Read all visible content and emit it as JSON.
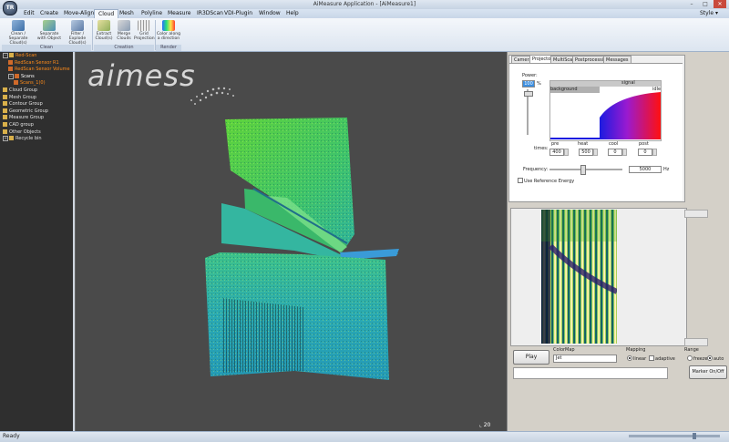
{
  "window": {
    "title": "AiMeasure Application - [AiMeasure1]",
    "logo_text": "TR",
    "minimize": "–",
    "maximize": "□",
    "close": "✕"
  },
  "menu": {
    "items": [
      "Edit",
      "Create",
      "Move-Align",
      "Cloud",
      "Mesh",
      "Polyline",
      "Measure",
      "IR3DScan",
      "VDI-Plugin",
      "Window",
      "Help"
    ],
    "active": "Cloud",
    "style_label": "Style ▾"
  },
  "ribbon": {
    "buttons": [
      {
        "label": "Clean / Separate Cloud(s)",
        "icon": "clean-cloud-icon"
      },
      {
        "label": "Separate with Object",
        "icon": "separate-object-icon"
      },
      {
        "label": "Filter / Explode Cloud(s)",
        "icon": "filter-explode-icon"
      },
      {
        "label": "Extract Cloud(s)",
        "icon": "extract-cloud-icon"
      },
      {
        "label": "Merge Clouds",
        "icon": "merge-clouds-icon"
      },
      {
        "label": "Grid Projection",
        "icon": "grid-projection-icon"
      },
      {
        "label": "Color along a direction",
        "icon": "color-direction-icon"
      }
    ],
    "groups": [
      "Clean",
      "Creation",
      "Render"
    ]
  },
  "tree": {
    "items": [
      {
        "label": "Red-Scan",
        "level": 0,
        "color": "#ff8c1a",
        "expander": "−"
      },
      {
        "label": "RedScan Sensor R1",
        "level": 1,
        "color": "#ff8c1a"
      },
      {
        "label": "RedScan Sensor Volume",
        "level": 1,
        "color": "#ff8c1a"
      },
      {
        "label": "Scans",
        "level": 1,
        "color": "#ffffff",
        "expander": "−"
      },
      {
        "label": "Scans_1(0)",
        "level": 2,
        "color": "#ff8c1a"
      },
      {
        "label": "Cloud Group",
        "level": 0,
        "color": "#e0e0e0"
      },
      {
        "label": "Mesh Group",
        "level": 0,
        "color": "#e0e0e0"
      },
      {
        "label": "Contour Group",
        "level": 0,
        "color": "#e0e0e0"
      },
      {
        "label": "Geometric Group",
        "level": 0,
        "color": "#e0e0e0"
      },
      {
        "label": "Measure Group",
        "level": 0,
        "color": "#e0e0e0"
      },
      {
        "label": "CAD group",
        "level": 0,
        "color": "#e0e0e0"
      },
      {
        "label": "Other Objects",
        "level": 0,
        "color": "#e0e0e0"
      },
      {
        "label": "Recycle bin",
        "level": 0,
        "color": "#e0e0e0",
        "expander": "+"
      }
    ]
  },
  "viewport": {
    "logo": "aimess",
    "axis_label": "20"
  },
  "tabs": [
    "Camera",
    "Projector",
    "MultiScan",
    "Postprocessing",
    "Messages"
  ],
  "active_tab": "Projector",
  "projector": {
    "power_label": "Power:",
    "power_value": "100",
    "power_unit": "%",
    "signal_label": "signal",
    "background_label": "background",
    "idle_label": "idle",
    "times_label": "times:",
    "time_columns": [
      {
        "label": "pre",
        "value": "400"
      },
      {
        "label": "heat",
        "value": "500"
      },
      {
        "label": "cool",
        "value": "0"
      },
      {
        "label": "post",
        "value": "0"
      }
    ],
    "frequency_label": "Frequency:",
    "frequency_value": "5000",
    "frequency_unit": "Hz",
    "ref_energy_label": "Use Reference Energy"
  },
  "bottom": {
    "play_label": "Play",
    "colormap_label": "ColorMap",
    "colormap_value": "Jet",
    "mapping_label": "Mapping",
    "mapping_linear": "linear",
    "mapping_adaptive": "adaptive",
    "range_label": "Range",
    "range_freeze": "freeze",
    "range_auto": "auto",
    "marker_label": "Marker On/Off"
  },
  "status": {
    "text": "Ready"
  }
}
